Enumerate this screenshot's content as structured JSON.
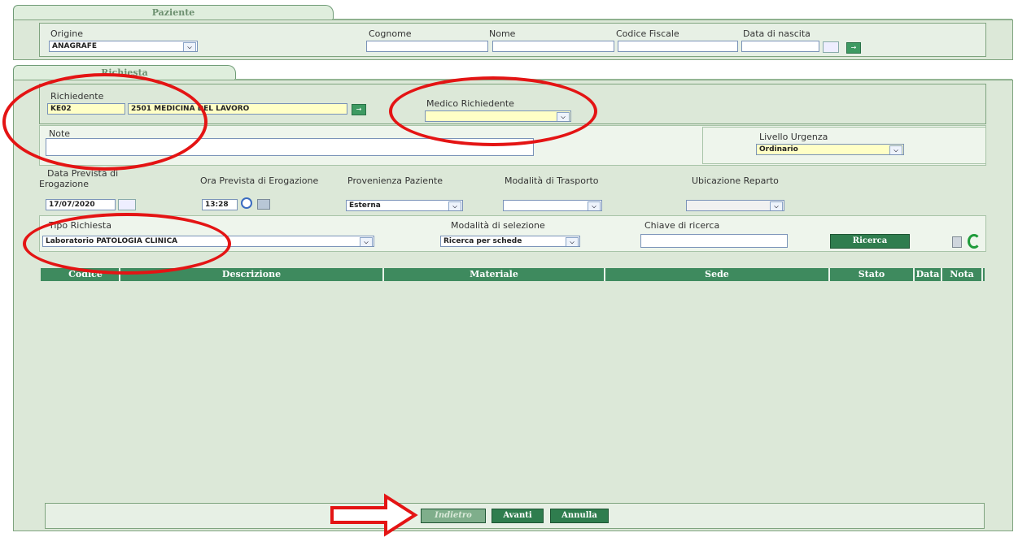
{
  "tabs": {
    "patient": "Paziente",
    "request": "Richiesta"
  },
  "patient": {
    "origin_label": "Origine",
    "origin_value": "ANAGRAFE",
    "surname_label": "Cognome",
    "name_label": "Nome",
    "fiscal_label": "Codice Fiscale",
    "birth_label": "Data di nascita"
  },
  "request": {
    "requester_label": "Richiedente",
    "requester_code": "KE02",
    "requester_name": "2501 MEDICINA DEL LAVORO",
    "doctor_label": "Medico Richiedente",
    "notes_label": "Note",
    "urgency_label": "Livello Urgenza",
    "urgency_value": "Ordinario",
    "date_label_1": "Data Prevista di",
    "date_label_2": "Erogazione",
    "date_value": "17/07/2020",
    "time_label": "Ora Prevista di Erogazione",
    "time_value": "13:28",
    "origin_patient_label": "Provenienza Paziente",
    "origin_patient_value": "Esterna",
    "transport_label": "Modalità di Trasporto",
    "ward_label": "Ubicazione Reparto",
    "type_label": "Tipo Richiesta",
    "type_value": "Laboratorio PATOLOGIA CLINICA",
    "selection_label": "Modalità di selezione",
    "selection_value": "Ricerca per schede",
    "key_label": "Chiave di ricerca",
    "search_button": "Ricerca"
  },
  "table_headers": [
    "Codice",
    "Descrizione",
    "Materiale",
    "Sede",
    "Stato",
    "Data",
    "Nota"
  ],
  "footer": {
    "back": "Indietro",
    "next": "Avanti",
    "cancel": "Annulla"
  },
  "icons": {
    "select_arrow": "⌵",
    "go_arrow": "→",
    "calendar": "calendar-icon",
    "clock": "clock-icon",
    "refresh": "refresh-icon"
  },
  "colors": {
    "panel": "#dce8d8",
    "header": "#3e8a5e",
    "button": "#2f7d4e",
    "annotation": "#e41414"
  }
}
